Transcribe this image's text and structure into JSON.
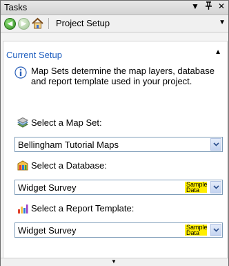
{
  "pane": {
    "title": "Tasks",
    "menu_glyph": "▼",
    "pin_glyph": "ᴘ",
    "close_glyph": "✕"
  },
  "nav": {
    "title": "Project Setup",
    "dropdown_glyph": "▼"
  },
  "section": {
    "heading": "Current Setup",
    "collapse_glyph": "▲",
    "info": "Map Sets determine the map layers, database and report template used in your project."
  },
  "map_set": {
    "label": "Select a Map Set:",
    "value": "Bellingham Tutorial Maps"
  },
  "database": {
    "label": "Select a Database:",
    "value": "Widget Survey",
    "badge": "Sample Data"
  },
  "report": {
    "label": "Select a Report Template:",
    "value": "Widget Survey",
    "badge": "Sample Data"
  },
  "footer": {
    "scroll_glyph": "▼"
  },
  "colors": {
    "heading": "#1e5ebf",
    "badge": "#ffee00"
  }
}
